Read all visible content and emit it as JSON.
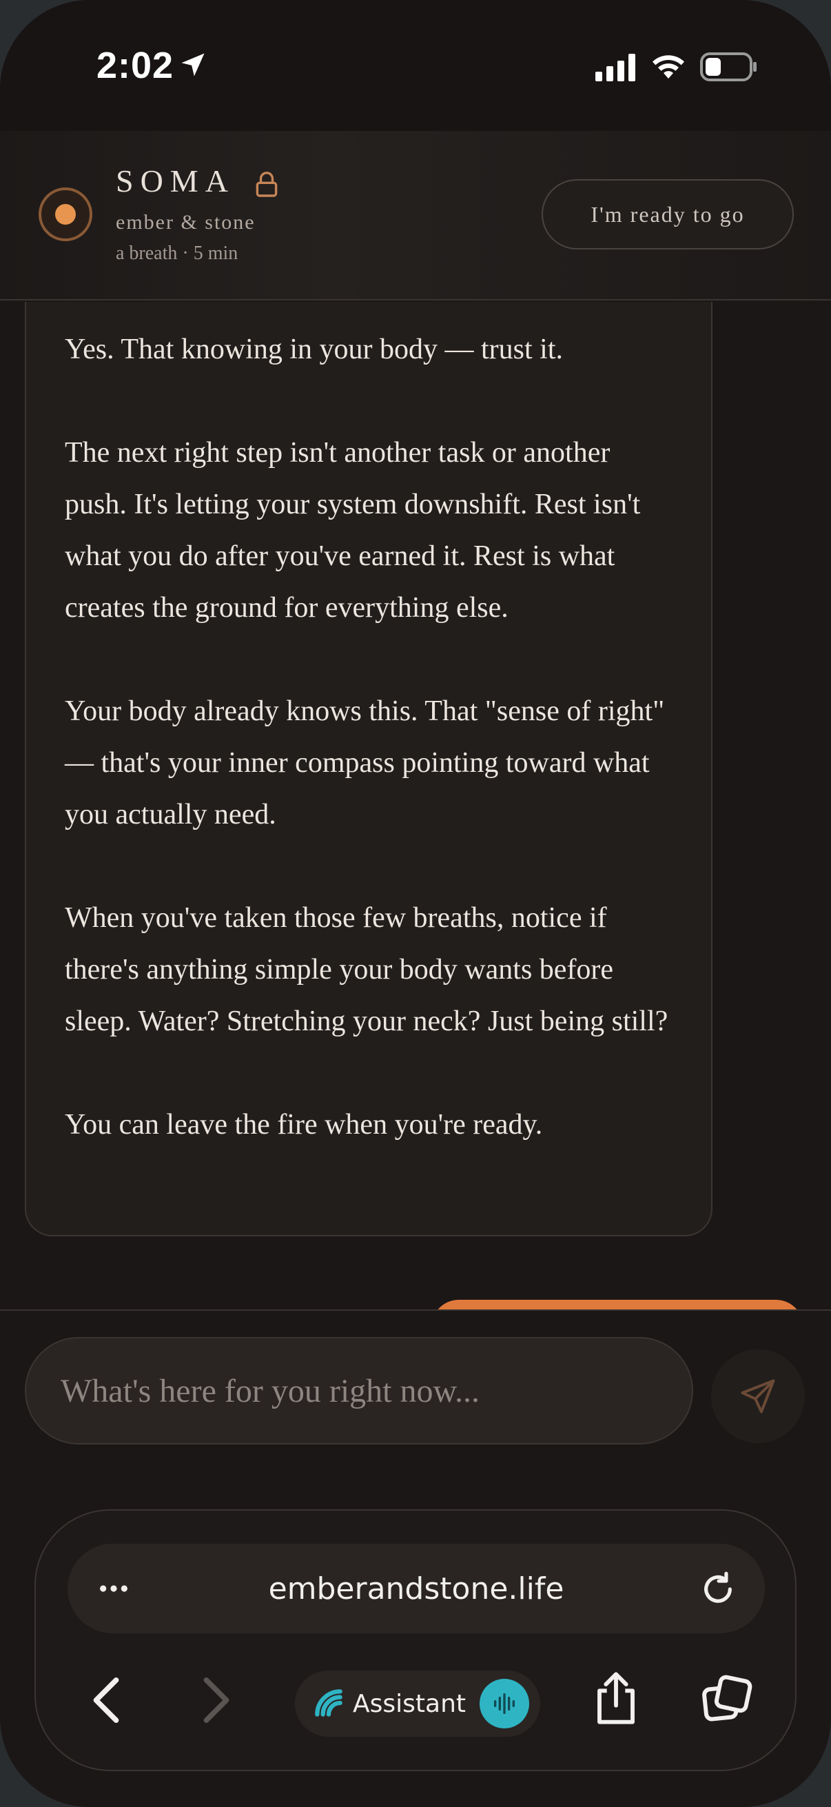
{
  "status_bar": {
    "time": "2:02",
    "icons": [
      "location-arrow-icon",
      "cellular-signal-icon",
      "wifi-icon",
      "battery-icon"
    ]
  },
  "header": {
    "brand": "SOMA",
    "subtitle": "ember & stone",
    "meta": "a breath · 5 min",
    "ready_button": "I'm ready to go",
    "icons": [
      "ember-dot-icon",
      "lock-icon"
    ],
    "colors": {
      "accent": "#e8954f",
      "user_bubble": "#e07a3c"
    }
  },
  "message": {
    "paragraphs": [
      "Yes. That knowing in your body — trust it.",
      "The next right step isn't another task or another push. It's letting your system downshift. Rest isn't what you do after you've earned it. Rest is what creates the ground for everything else.",
      "Your body already knows this. That \"sense of right\" — that's your inner compass pointing toward what you actually need.",
      "When you've taken those few breaths, notice if there's anything simple your body wants before sleep. Water? Stretching your neck? Just being still?",
      "You can leave the fire when you're ready."
    ]
  },
  "composer": {
    "placeholder": "What's here for you right now...",
    "icons": [
      "send-icon"
    ]
  },
  "browser": {
    "url": "emberandstone.life",
    "assistant_label": "Assistant",
    "icons": [
      "more-icon",
      "reload-icon",
      "back-icon",
      "forward-icon",
      "assistant-logo-icon",
      "voice-icon",
      "share-icon",
      "tabs-icon"
    ],
    "colors": {
      "assistant_accent": "#2fb4c4"
    }
  }
}
